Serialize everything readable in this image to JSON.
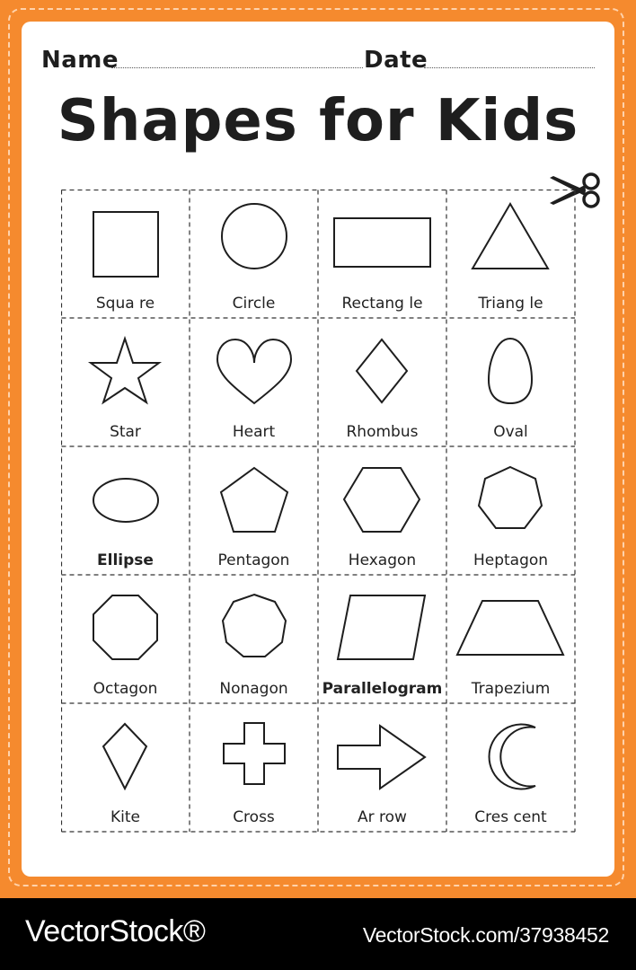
{
  "header": {
    "name_label": "Name",
    "date_label": "Date",
    "title": "Shapes for Kids"
  },
  "cut_icon": "scissors-icon",
  "colors": {
    "border": "#f58a2e",
    "paper": "#ffffff",
    "ink": "#1e1e1e",
    "footer": "#000000"
  },
  "shapes": [
    {
      "label": "Squa re",
      "icon": "square-icon",
      "bold": false
    },
    {
      "label": "Circle",
      "icon": "circle-icon",
      "bold": false
    },
    {
      "label": "Rectang le",
      "icon": "rectangle-icon",
      "bold": false
    },
    {
      "label": "Triang le",
      "icon": "triangle-icon",
      "bold": false
    },
    {
      "label": "Star",
      "icon": "star-icon",
      "bold": false
    },
    {
      "label": "Heart",
      "icon": "heart-icon",
      "bold": false
    },
    {
      "label": "Rhombus",
      "icon": "rhombus-icon",
      "bold": false
    },
    {
      "label": "Oval",
      "icon": "oval-icon",
      "bold": false
    },
    {
      "label": "Ellipse",
      "icon": "ellipse-icon",
      "bold": true
    },
    {
      "label": "Pentagon",
      "icon": "pentagon-icon",
      "bold": false
    },
    {
      "label": "Hexagon",
      "icon": "hexagon-icon",
      "bold": false
    },
    {
      "label": "Heptagon",
      "icon": "heptagon-icon",
      "bold": false
    },
    {
      "label": "Octagon",
      "icon": "octagon-icon",
      "bold": false
    },
    {
      "label": "Nonagon",
      "icon": "nonagon-icon",
      "bold": false
    },
    {
      "label": "Parallelogram",
      "icon": "parallelogram-icon",
      "bold": true
    },
    {
      "label": "Trapezium",
      "icon": "trapezium-icon",
      "bold": false
    },
    {
      "label": "Kite",
      "icon": "kite-icon",
      "bold": false
    },
    {
      "label": "Cross",
      "icon": "cross-icon",
      "bold": false
    },
    {
      "label": "Ar row",
      "icon": "arrow-icon",
      "bold": false
    },
    {
      "label": "Cres cent",
      "icon": "crescent-icon",
      "bold": false
    }
  ],
  "footer": {
    "brand": "VectorStock®",
    "stock_id": "VectorStock.com/37938452"
  }
}
